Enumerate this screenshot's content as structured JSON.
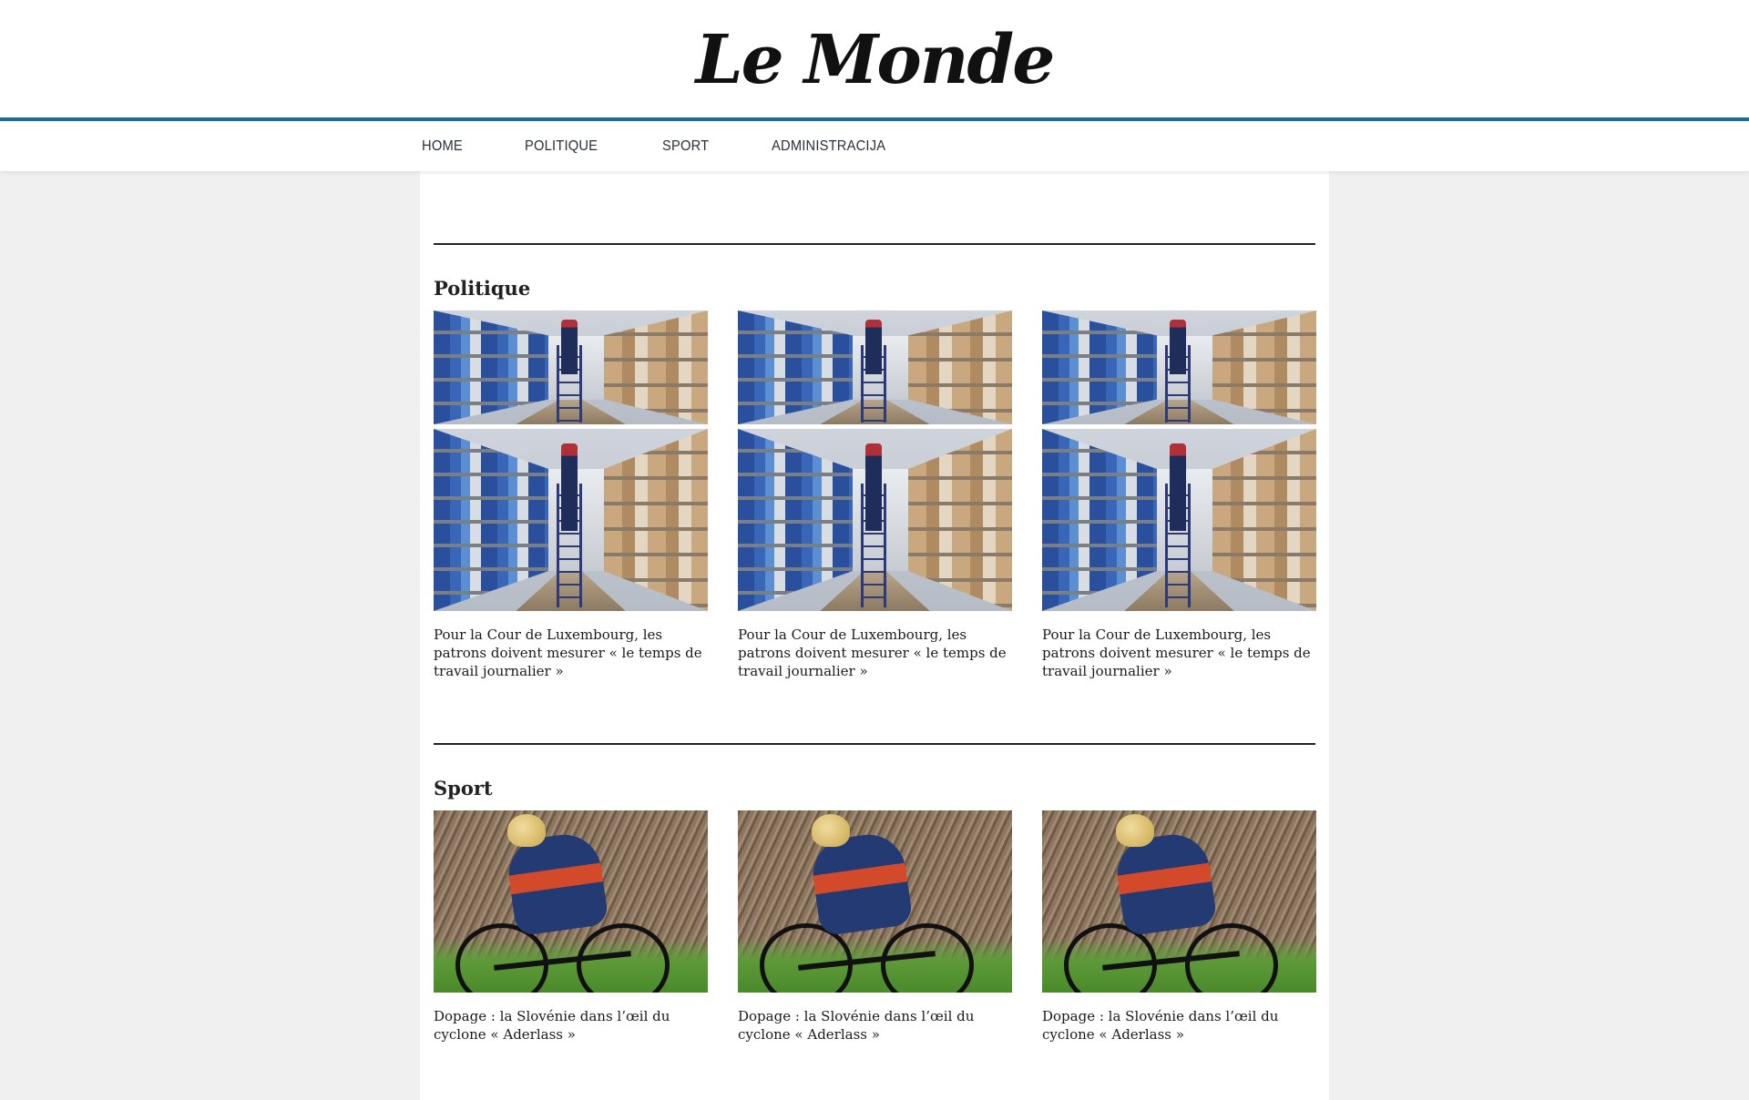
{
  "site": {
    "logo_text": "Le Monde",
    "accent_color": "#1a6c9a"
  },
  "nav": {
    "items": [
      "HOME",
      "POLITIQUE",
      "SPORT",
      "ADMINISTRACIJA"
    ]
  },
  "sections": [
    {
      "title": "Politique",
      "articles": [
        {
          "title": "Pour la Cour de Luxembourg, les patrons doivent mesurer « le temps de travail journalier »",
          "image": "warehouse-photo"
        },
        {
          "title": "Pour la Cour de Luxembourg, les patrons doivent mesurer « le temps de travail journalier »",
          "image": "warehouse-photo"
        },
        {
          "title": "Pour la Cour de Luxembourg, les patrons doivent mesurer « le temps de travail journalier »",
          "image": "warehouse-photo"
        }
      ]
    },
    {
      "title": "Sport",
      "articles": [
        {
          "title": "Dopage : la Slovénie dans l’œil du cyclone « Aderlass »",
          "image": "cyclist-photo"
        },
        {
          "title": "Dopage : la Slovénie dans l’œil du cyclone « Aderlass »",
          "image": "cyclist-photo"
        },
        {
          "title": "Dopage : la Slovénie dans l’œil du cyclone « Aderlass »",
          "image": "cyclist-photo"
        }
      ]
    }
  ]
}
